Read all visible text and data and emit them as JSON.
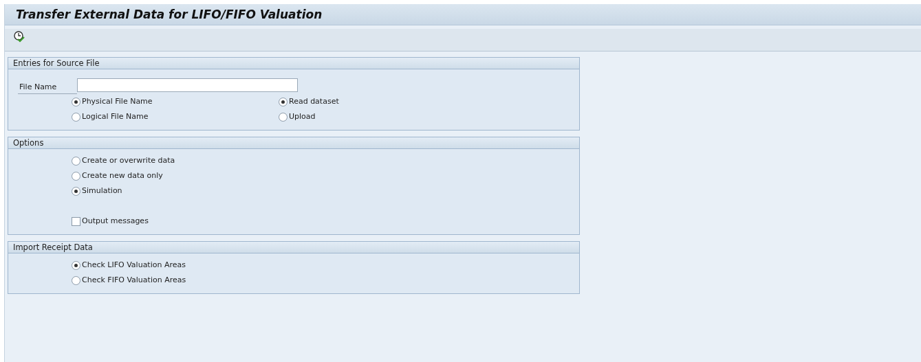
{
  "window": {
    "title": "Transfer External Data for LIFO/FIFO Valuation"
  },
  "groups": [
    {
      "title": "Entries for Source File",
      "rows": [
        {
          "kind": "field",
          "label": "File Name",
          "value": ""
        },
        {
          "kind": "radio",
          "items": [
            {
              "label": "Physical File Name",
              "selected": true
            },
            {
              "label": "Read dataset",
              "selected": true
            }
          ]
        },
        {
          "kind": "radio",
          "items": [
            {
              "label": "Logical File Name",
              "selected": false
            },
            {
              "label": "Upload",
              "selected": false
            }
          ]
        }
      ]
    },
    {
      "title": "Options",
      "rows": [
        {
          "kind": "radio",
          "items": [
            {
              "label": "Create or overwrite data",
              "selected": false
            }
          ]
        },
        {
          "kind": "radio",
          "items": [
            {
              "label": "Create new data only",
              "selected": false
            }
          ]
        },
        {
          "kind": "radio",
          "items": [
            {
              "label": "Simulation",
              "selected": true
            }
          ]
        },
        {
          "kind": "checkbox",
          "items": [
            {
              "label": "Output messages",
              "checked": false
            }
          ]
        }
      ]
    },
    {
      "title": "Import Receipt Data",
      "rows": [
        {
          "kind": "radio",
          "items": [
            {
              "label": "Check LIFO Valuation Areas",
              "selected": true
            }
          ]
        },
        {
          "kind": "radio",
          "items": [
            {
              "label": "Check FIFO Valuation Areas",
              "selected": false
            }
          ]
        }
      ]
    }
  ]
}
